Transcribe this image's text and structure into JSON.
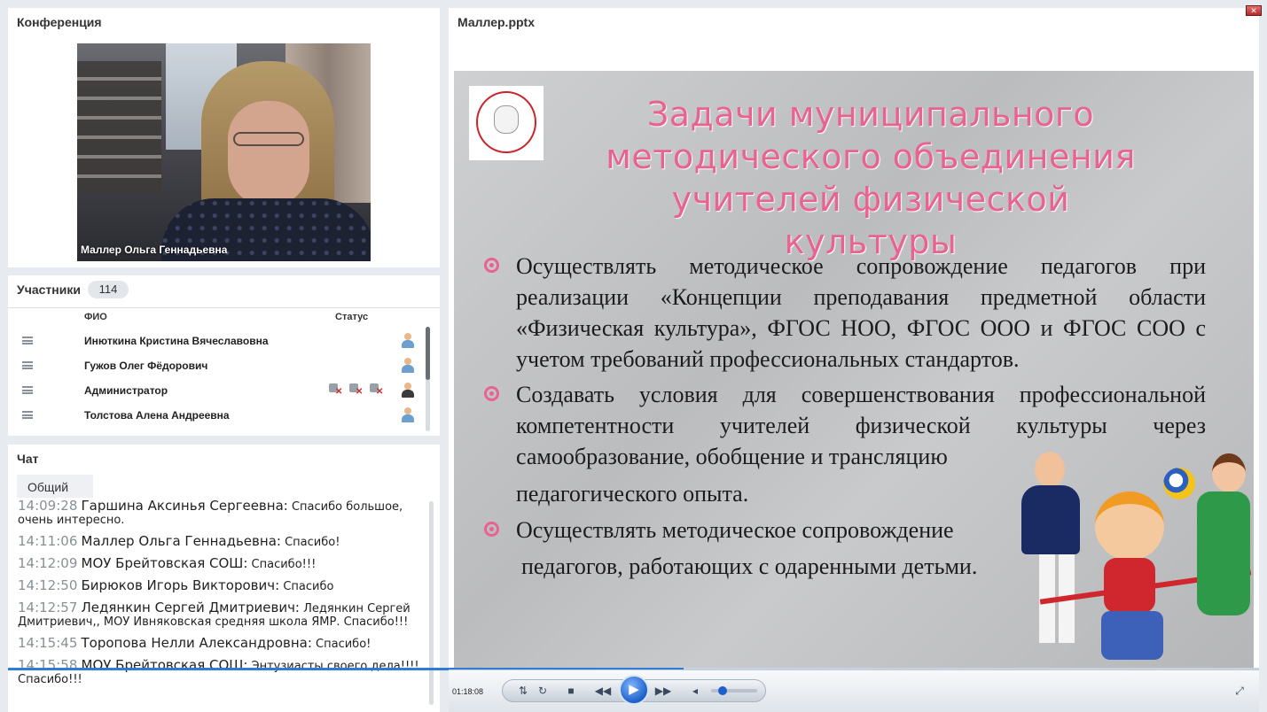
{
  "conference": {
    "title": "Конференция",
    "speaker_caption": "Маллер  Ольга  Геннадьевна"
  },
  "participants": {
    "title": "Участники",
    "count": "114",
    "col_name": "ФИО",
    "col_status": "Статус",
    "rows": [
      {
        "name": "Инюткина  Кристина Вячеславовна"
      },
      {
        "name": "Гужов Олег  Фёдорович"
      },
      {
        "name": "Администратор"
      },
      {
        "name": "Толстова Алена  Андреевна"
      }
    ]
  },
  "chat": {
    "title": "Чат",
    "tab": "Общий",
    "messages": [
      {
        "time": "14:09:28",
        "author": "Гаршина  Аксинья   Сергеевна:",
        "text": "Спасибо большое, очень интересно."
      },
      {
        "time": "14:11:06",
        "author": "Маллер  Ольга  Геннадьевна:",
        "text": "Спасибо!"
      },
      {
        "time": "14:12:09",
        "author": "МОУ Брейтовская СОШ:",
        "text": "Спасибо!!!"
      },
      {
        "time": "14:12:50",
        "author": "Бирюков  Игорь  Викторович:",
        "text": "Спасибо"
      },
      {
        "time": "14:12:57",
        "author": "Ледянкин Сергей  Дмитриевич:",
        "text": "Ледянкин Сергей Дмитриевич,, МОУ Ивняковская средняя школа ЯМР. Спасибо!!!"
      },
      {
        "time": "14:15:45",
        "author": "Торопова  Нелли  Александровна:",
        "text": "Спасибо!"
      },
      {
        "time": "14:15:58",
        "author": "МОУ Брейтовская СОШ:",
        "text": "Энтузиасты своего дела!!!! Спасибо!!!"
      }
    ]
  },
  "presentation": {
    "file_title": "Маллер.pptx",
    "slide": {
      "title_line1": "Задачи муниципального",
      "title_line2": "методического объединения",
      "title_line3": "учителей физической культуры",
      "bullet1": "Осуществлять методическое сопровождение педагогов при реализации «Концепции преподавания предметной области «Физическая культура», ФГОС НОО, ФГОС ООО и ФГОС СОО с учетом требований профессиональных стандартов.",
      "bullet2": "Создавать условия для совершенствования профессиональной компетентности учителей физической культуры через самообразование, обобщение и трансляцию",
      "bullet2b": "педагогического опыта.",
      "bullet3": "Осуществлять методическое сопровождение",
      "bullet3b": "педагогов, работающих с одаренными детьми."
    }
  },
  "player": {
    "time": "01:18:08",
    "progress": 0.54,
    "volume": 0.2
  },
  "colors": {
    "accent": "#e8638f",
    "play": "#1e5fc9"
  }
}
